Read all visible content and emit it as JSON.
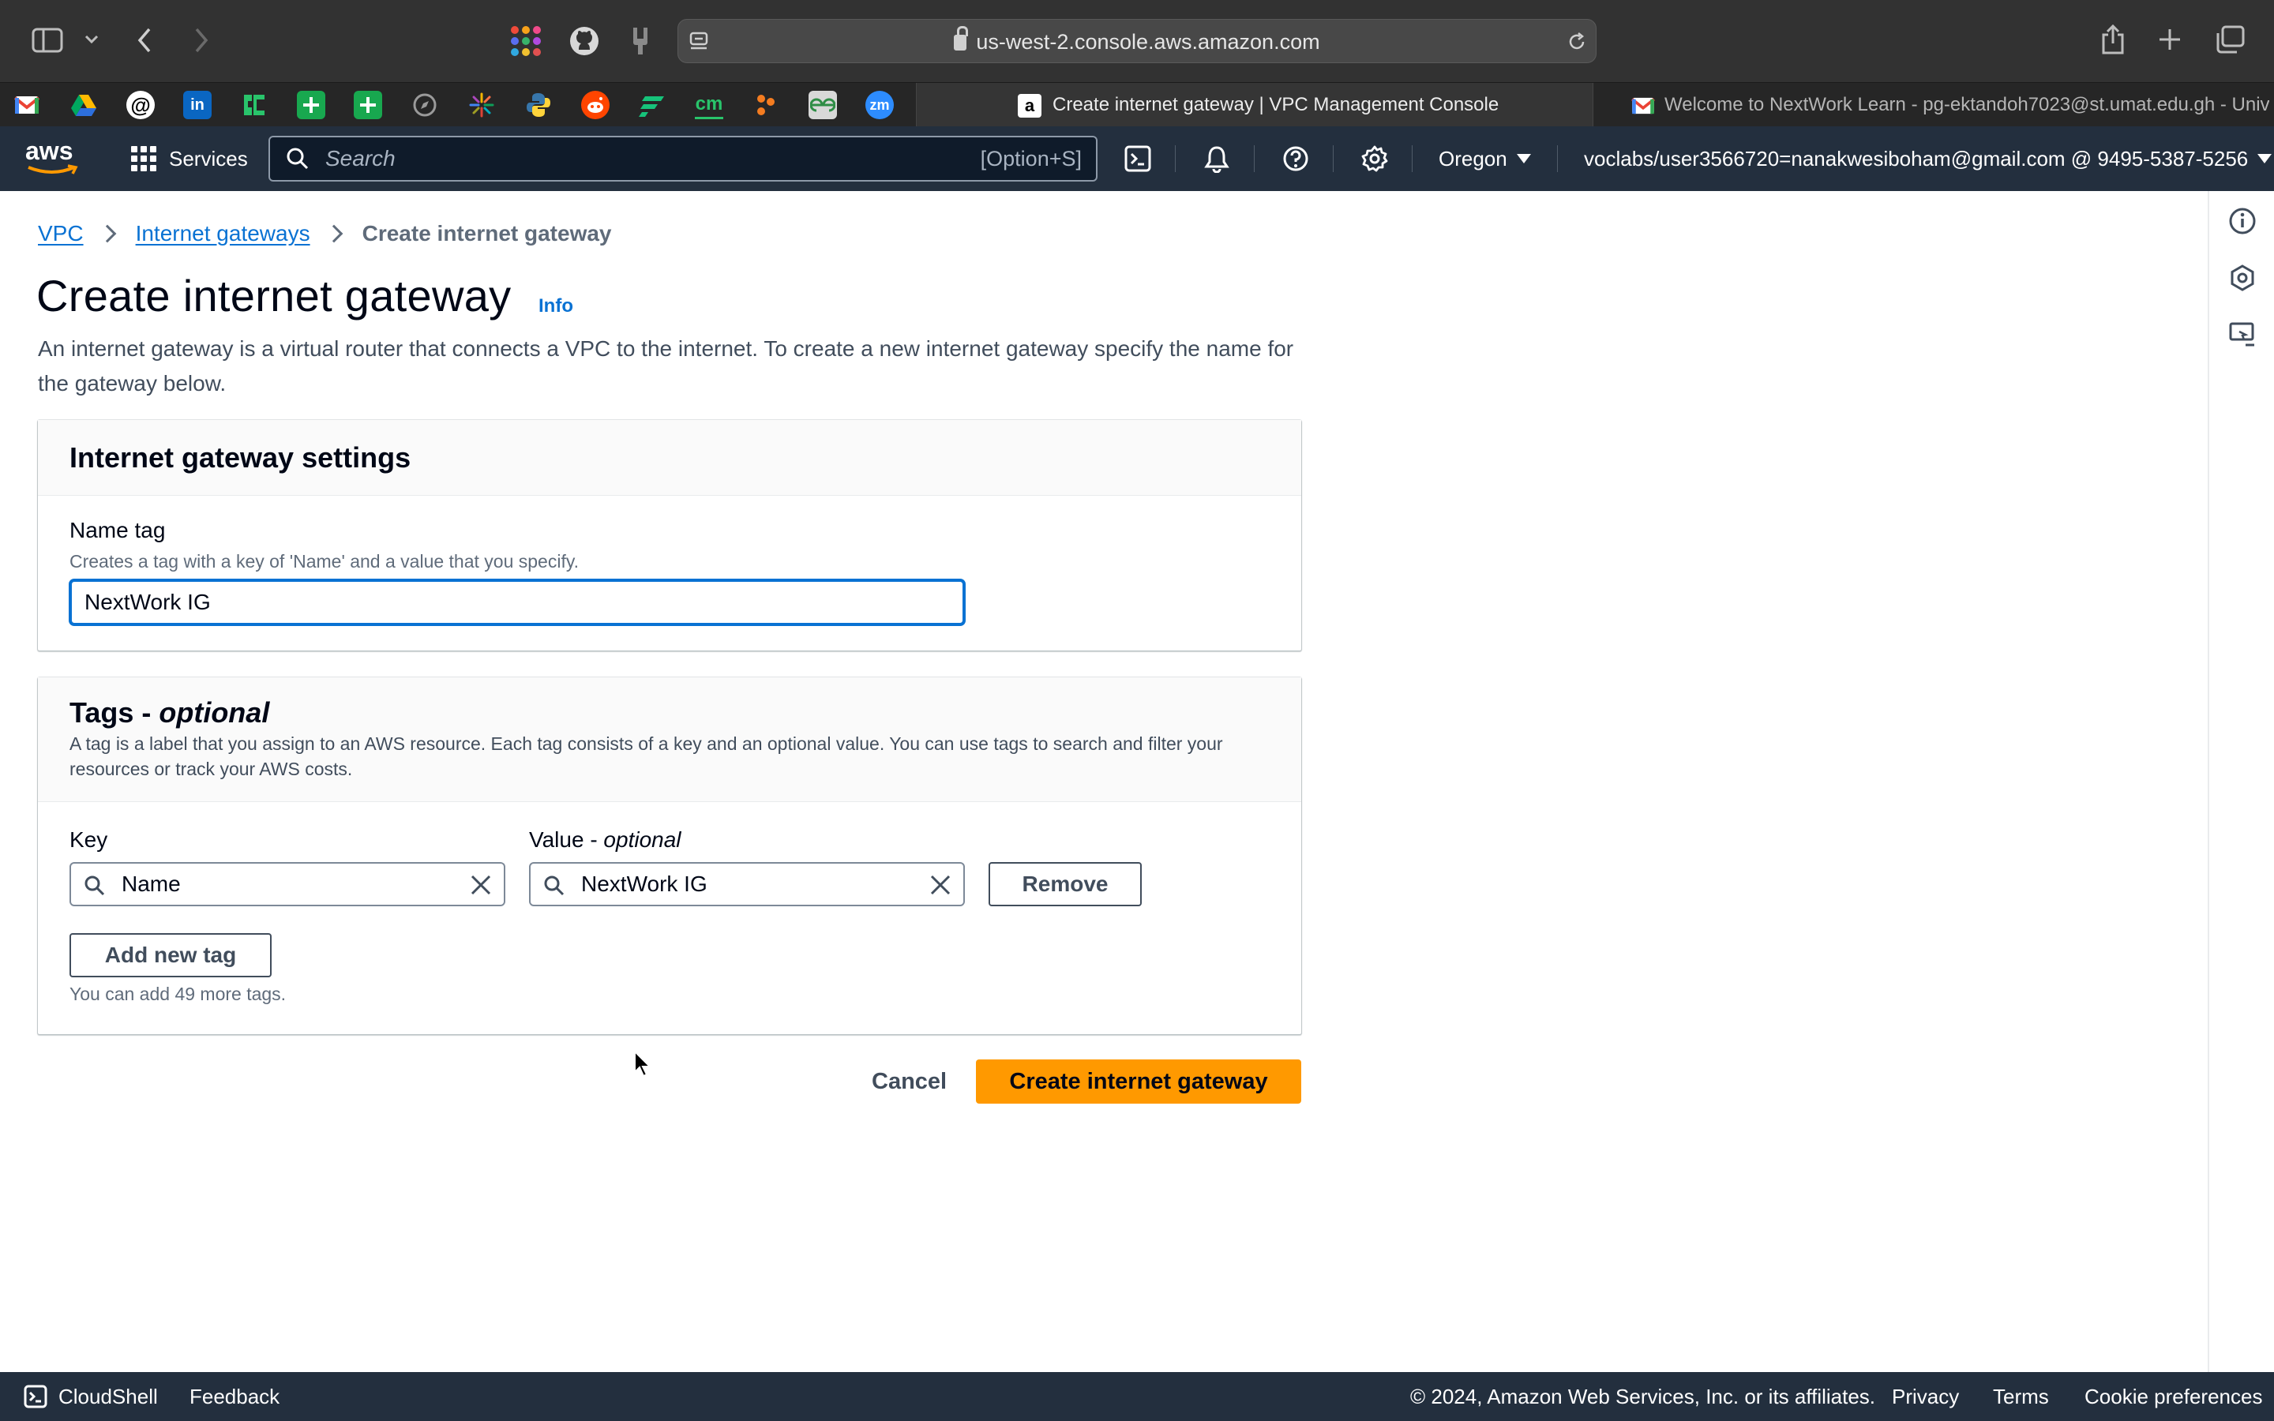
{
  "browser": {
    "url": "us-west-2.console.aws.amazon.com",
    "active_tab_title": "Create internet gateway | VPC Management Console",
    "inactive_tab_title": "Welcome to NextWork Learn - pg-ektandoh7023@st.umat.edu.gh - Univ...",
    "tab_icons": [
      "gmail-icon",
      "google-drive-icon",
      "threads-icon",
      "linkedin-icon",
      "phone-app-icon",
      "sheets-icon",
      "sheets-icon",
      "compass-icon",
      "sparkle-icon",
      "python-icon",
      "reddit-icon",
      "app-icon",
      "cm-icon",
      "dots-icon",
      "geeksforgeeks-icon",
      "zoom-icon"
    ],
    "fav_texts": {
      "linkedin": "in",
      "cm": "cm",
      "zoom": "zm"
    }
  },
  "aws_nav": {
    "logo": "aws",
    "services_label": "Services",
    "search_placeholder": "Search",
    "search_shortcut": "[Option+S]",
    "region": "Oregon",
    "account": "voclabs/user3566720=nanakwesiboham@gmail.com @ 9495-5387-5256"
  },
  "breadcrumb": {
    "items": [
      "VPC",
      "Internet gateways",
      "Create internet gateway"
    ]
  },
  "page": {
    "title": "Create internet gateway",
    "info_link": "Info",
    "description": "An internet gateway is a virtual router that connects a VPC to the internet. To create a new internet gateway specify the name for the gateway below."
  },
  "settings_panel": {
    "title": "Internet gateway settings",
    "name_tag_label": "Name tag",
    "name_tag_description": "Creates a tag with a key of 'Name' and a value that you specify.",
    "name_tag_value": "NextWork IG"
  },
  "tags_panel": {
    "title_main": "Tags - ",
    "title_optional": "optional",
    "description": "A tag is a label that you assign to an AWS resource. Each tag consists of a key and an optional value. You can use tags to search and filter your resources or track your AWS costs.",
    "key_label": "Key",
    "value_label_main": "Value - ",
    "value_label_optional": "optional",
    "key_value": "Name",
    "tag_value": "NextWork IG",
    "remove_button": "Remove",
    "add_button": "Add new tag",
    "limit_text": "You can add 49 more tags."
  },
  "actions": {
    "cancel": "Cancel",
    "create": "Create internet gateway"
  },
  "footer": {
    "cloudshell": "CloudShell",
    "feedback": "Feedback",
    "copyright": "© 2024, Amazon Web Services, Inc. or its affiliates.",
    "privacy": "Privacy",
    "terms": "Terms",
    "cookie": "Cookie preferences"
  },
  "colors": {
    "aws_nav_bg": "#232f3e",
    "link": "#0972d3",
    "primary_button": "#ff9900",
    "browser_chrome": "#323232"
  }
}
